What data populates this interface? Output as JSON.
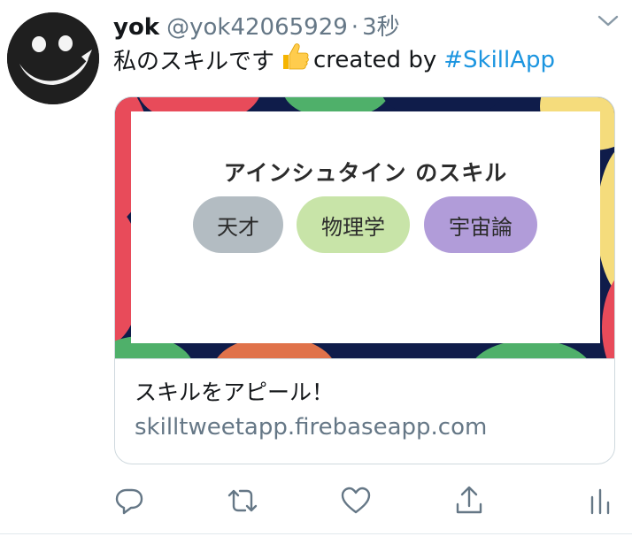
{
  "tweet": {
    "display_name": "yok",
    "handle": "@yok42065929",
    "separator": "·",
    "time": "3秒",
    "text_before": "私のスキルです",
    "text_emoji": "thumbs-up-emoji",
    "text_after": "created by",
    "hashtag": "#SkillApp"
  },
  "card": {
    "title": "アインシュタイン のスキル",
    "skills": [
      {
        "label": "天才",
        "color": "#b3bcc2"
      },
      {
        "label": "物理学",
        "color": "#c8e4a8"
      },
      {
        "label": "宇宙論",
        "color": "#b19cd9"
      }
    ],
    "description": "スキルをアピール！",
    "domain": "skilltweetapp.firebaseapp.com"
  },
  "actions": [
    {
      "name": "reply",
      "icon": "reply-icon"
    },
    {
      "name": "retweet",
      "icon": "retweet-icon"
    },
    {
      "name": "like",
      "icon": "heart-icon"
    },
    {
      "name": "share",
      "icon": "share-icon"
    },
    {
      "name": "analytics",
      "icon": "analytics-icon"
    }
  ],
  "colors": {
    "text": "#14171a",
    "secondary": "#657786",
    "link": "#1b95e0",
    "icon": "#657786"
  }
}
